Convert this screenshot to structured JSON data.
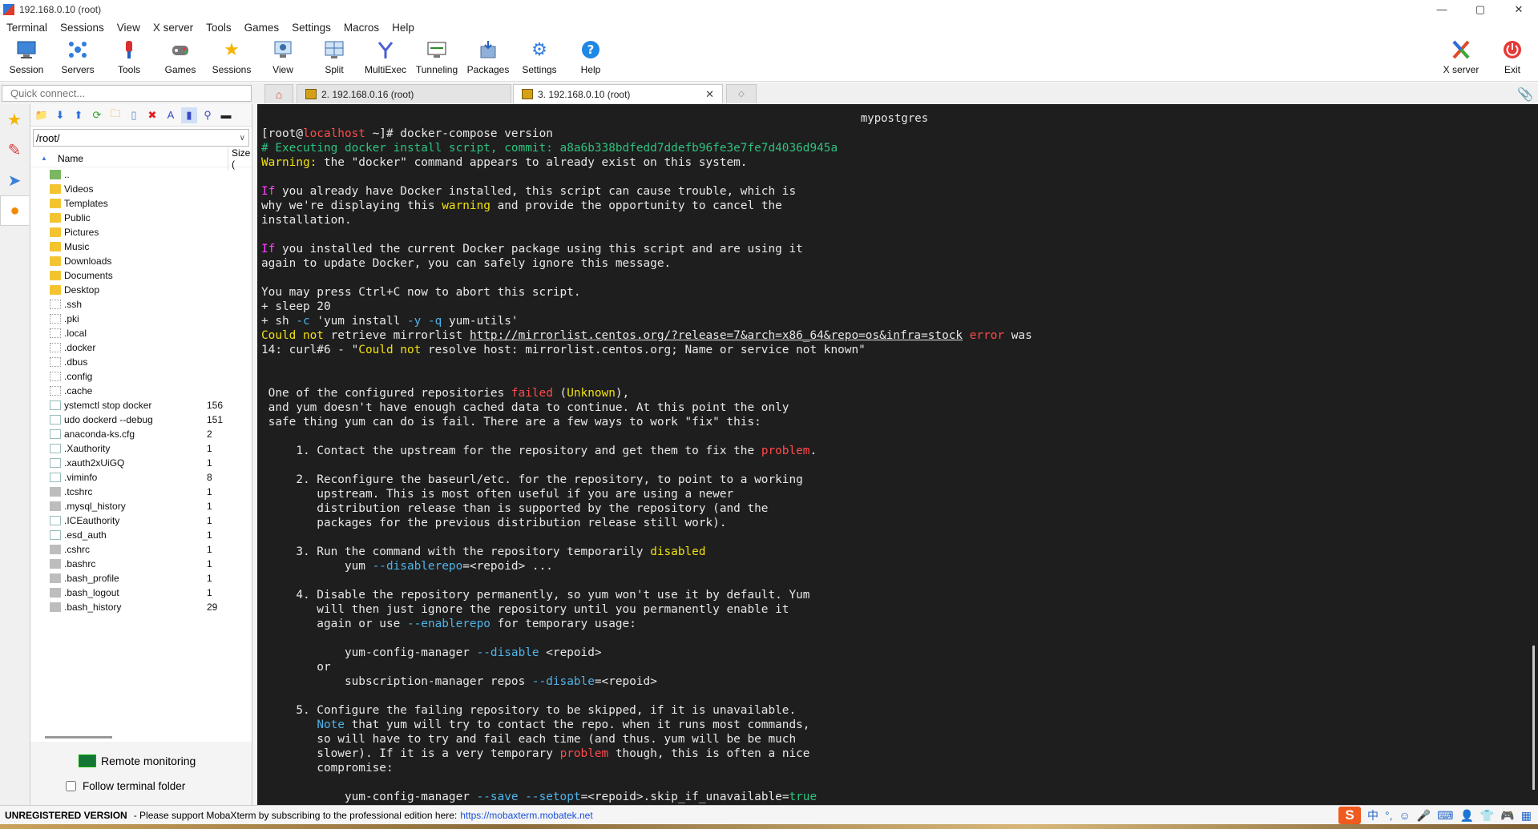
{
  "window": {
    "title": "192.168.0.10 (root)",
    "controls": {
      "minimize": "—",
      "maximize": "▢",
      "close": "✕"
    }
  },
  "menubar": [
    "Terminal",
    "Sessions",
    "View",
    "X server",
    "Tools",
    "Games",
    "Settings",
    "Macros",
    "Help"
  ],
  "toolbar": {
    "session": "Session",
    "servers": "Servers",
    "tools": "Tools",
    "games": "Games",
    "sessions": "Sessions",
    "view": "View",
    "split": "Split",
    "multiexec": "MultiExec",
    "tunneling": "Tunneling",
    "packages": "Packages",
    "settings": "Settings",
    "help": "Help",
    "xserver": "X server",
    "exit": "Exit"
  },
  "quick_connect": {
    "placeholder": "Quick connect..."
  },
  "tabs": [
    {
      "label": "2. 192.168.0.16 (root)",
      "active": false
    },
    {
      "label": "3. 192.168.0.10 (root)",
      "active": true
    }
  ],
  "file_panel": {
    "path": "/root/",
    "columns": {
      "name": "Name",
      "size": "Size ("
    },
    "files": [
      {
        "name": "..",
        "size": "",
        "type": "up"
      },
      {
        "name": "Videos",
        "size": "",
        "type": "folder"
      },
      {
        "name": "Templates",
        "size": "",
        "type": "folder"
      },
      {
        "name": "Public",
        "size": "",
        "type": "folder"
      },
      {
        "name": "Pictures",
        "size": "",
        "type": "folder"
      },
      {
        "name": "Music",
        "size": "",
        "type": "folder"
      },
      {
        "name": "Downloads",
        "size": "",
        "type": "folder"
      },
      {
        "name": "Documents",
        "size": "",
        "type": "folder"
      },
      {
        "name": "Desktop",
        "size": "",
        "type": "folder"
      },
      {
        "name": ".ssh",
        "size": "",
        "type": "dotfolder"
      },
      {
        "name": ".pki",
        "size": "",
        "type": "dotfolder"
      },
      {
        "name": ".local",
        "size": "",
        "type": "dotfolder"
      },
      {
        "name": ".docker",
        "size": "",
        "type": "dotfolder"
      },
      {
        "name": ".dbus",
        "size": "",
        "type": "dotfolder"
      },
      {
        "name": ".config",
        "size": "",
        "type": "dotfolder"
      },
      {
        "name": ".cache",
        "size": "",
        "type": "dotfolder"
      },
      {
        "name": "ystemctl stop docker",
        "size": "156",
        "type": "file"
      },
      {
        "name": "udo dockerd --debug",
        "size": "151",
        "type": "file"
      },
      {
        "name": "anaconda-ks.cfg",
        "size": "2",
        "type": "file"
      },
      {
        "name": ".Xauthority",
        "size": "1",
        "type": "file"
      },
      {
        "name": ".xauth2xUiGQ",
        "size": "1",
        "type": "file"
      },
      {
        "name": ".viminfo",
        "size": "8",
        "type": "file"
      },
      {
        "name": ".tcshrc",
        "size": "1",
        "type": "gray"
      },
      {
        "name": ".mysql_history",
        "size": "1",
        "type": "gray"
      },
      {
        "name": ".ICEauthority",
        "size": "1",
        "type": "file"
      },
      {
        "name": ".esd_auth",
        "size": "1",
        "type": "file"
      },
      {
        "name": ".cshrc",
        "size": "1",
        "type": "gray"
      },
      {
        "name": ".bashrc",
        "size": "1",
        "type": "gray"
      },
      {
        "name": ".bash_profile",
        "size": "1",
        "type": "gray"
      },
      {
        "name": ".bash_logout",
        "size": "1",
        "type": "gray"
      },
      {
        "name": ".bash_history",
        "size": "29",
        "type": "gray"
      }
    ],
    "remote_monitoring": "Remote monitoring",
    "follow_terminal_folder": "Follow terminal folder"
  },
  "terminal": {
    "title": "mypostgres",
    "lines": [
      [
        {
          "t": "[root@"
        },
        {
          "t": "localhost",
          "c": "red"
        },
        {
          "t": " ~]# docker-compose version"
        }
      ],
      [
        {
          "t": "# Executing docker install script, commit: a8a6b338bdfedd7ddefb96fe3e7fe7d4036d945a",
          "c": "grn"
        }
      ],
      [
        {
          "t": "Warning:",
          "c": "yel"
        },
        {
          "t": " the \"docker\" command appears to already exist on this system."
        }
      ],
      [],
      [
        {
          "t": "If",
          "c": "mag"
        },
        {
          "t": " you already have Docker installed, this script can cause trouble, which is"
        }
      ],
      [
        {
          "t": "why we're displaying this "
        },
        {
          "t": "warning",
          "c": "yel"
        },
        {
          "t": " and provide the opportunity to cancel the"
        }
      ],
      [
        {
          "t": "installation."
        }
      ],
      [],
      [
        {
          "t": "If",
          "c": "mag"
        },
        {
          "t": " you installed the current Docker package using this script and are using it"
        }
      ],
      [
        {
          "t": "again to update Docker, you can safely ignore this message."
        }
      ],
      [],
      [
        {
          "t": "You may press Ctrl+C now to abort this script."
        }
      ],
      [
        {
          "t": "+ sleep 20"
        }
      ],
      [
        {
          "t": "+ sh "
        },
        {
          "t": "-c",
          "c": "cyn"
        },
        {
          "t": " 'yum install "
        },
        {
          "t": "-y -q",
          "c": "cyn"
        },
        {
          "t": " yum-utils'"
        }
      ],
      [
        {
          "t": "Could not",
          "c": "yel"
        },
        {
          "t": " retrieve mirrorlist "
        },
        {
          "t": "http://mirrorlist.centos.org/?release=7&arch=x86_64&repo=os&infra=stock",
          "u": true
        },
        {
          "t": " "
        },
        {
          "t": "error",
          "c": "red"
        },
        {
          "t": " was"
        }
      ],
      [
        {
          "t": "14: curl#6 - \""
        },
        {
          "t": "Could not",
          "c": "yel"
        },
        {
          "t": " resolve host: mirrorlist.centos.org; Name or service not known\""
        }
      ],
      [],
      [],
      [
        {
          "t": " One of the configured repositories "
        },
        {
          "t": "failed",
          "c": "red"
        },
        {
          "t": " ("
        },
        {
          "t": "Unknown",
          "c": "yel"
        },
        {
          "t": "),"
        }
      ],
      [
        {
          "t": " and yum doesn't have enough cached data to continue. At this point the only"
        }
      ],
      [
        {
          "t": " safe thing yum can do is fail. There are a few ways to work \"fix\" this:"
        }
      ],
      [],
      [
        {
          "t": "     1. Contact the upstream for the repository and get them to fix the "
        },
        {
          "t": "problem",
          "c": "red"
        },
        {
          "t": "."
        }
      ],
      [],
      [
        {
          "t": "     2. Reconfigure the baseurl/etc. for the repository, to point to a working"
        }
      ],
      [
        {
          "t": "        upstream. This is most often useful if you are using a newer"
        }
      ],
      [
        {
          "t": "        distribution release than is supported by the repository (and the"
        }
      ],
      [
        {
          "t": "        packages for the previous distribution release still work)."
        }
      ],
      [],
      [
        {
          "t": "     3. Run the command with the repository temporarily "
        },
        {
          "t": "disabled",
          "c": "yel"
        }
      ],
      [
        {
          "t": "            yum "
        },
        {
          "t": "--disablerepo",
          "c": "cyn"
        },
        {
          "t": "=<repoid> ..."
        }
      ],
      [],
      [
        {
          "t": "     4. Disable the repository permanently, so yum won't use it by default. Yum"
        }
      ],
      [
        {
          "t": "        will then just ignore the repository until you permanently enable it"
        }
      ],
      [
        {
          "t": "        again or use "
        },
        {
          "t": "--enablerepo",
          "c": "cyn"
        },
        {
          "t": " for temporary usage:"
        }
      ],
      [],
      [
        {
          "t": "            yum-config-manager "
        },
        {
          "t": "--disable",
          "c": "cyn"
        },
        {
          "t": " <repoid>"
        }
      ],
      [
        {
          "t": "        or"
        }
      ],
      [
        {
          "t": "            subscription-manager repos "
        },
        {
          "t": "--disable",
          "c": "cyn"
        },
        {
          "t": "=<repoid>"
        }
      ],
      [],
      [
        {
          "t": "     5. Configure the failing repository to be skipped, if it is unavailable."
        }
      ],
      [
        {
          "t": "        "
        },
        {
          "t": "Note",
          "c": "cyn"
        },
        {
          "t": " that yum will try to contact the repo. when it runs most commands,"
        }
      ],
      [
        {
          "t": "        so will have to try and fail each time (and thus. yum will be be much"
        }
      ],
      [
        {
          "t": "        slower). If it is a very temporary "
        },
        {
          "t": "problem",
          "c": "red"
        },
        {
          "t": " though, this is often a nice"
        }
      ],
      [
        {
          "t": "        compromise:"
        }
      ],
      [],
      [
        {
          "t": "            yum-config-manager "
        },
        {
          "t": "--save --setopt",
          "c": "cyn"
        },
        {
          "t": "=<repoid>.skip_if_unavailable="
        },
        {
          "t": "true",
          "c": "grn"
        }
      ]
    ]
  },
  "statusbar": {
    "unregistered": "UNREGISTERED VERSION",
    "message": "-  Please support MobaXterm by subscribing to the professional edition here:",
    "link": "https://mobaxterm.mobatek.net"
  },
  "tray": {
    "ime_label": "S",
    "lang": "中"
  },
  "colors": {
    "terminal_bg": "#1e1e1e",
    "red": "#ff4b4b",
    "yellow": "#f0e010",
    "green": "#2ec27e",
    "cyan": "#4fb3e8",
    "magenta": "#ff40ff"
  }
}
